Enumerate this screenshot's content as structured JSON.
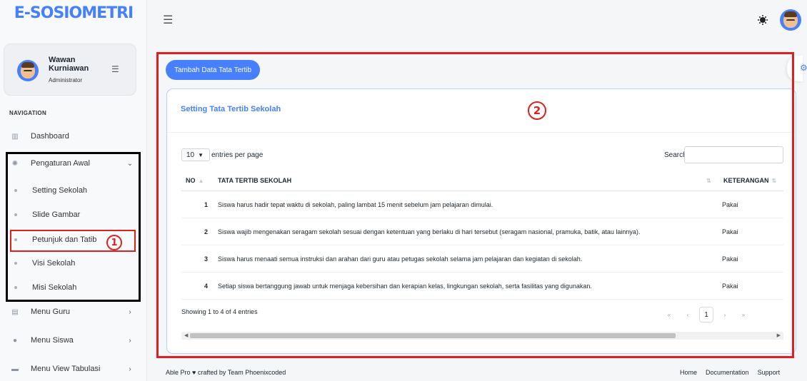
{
  "app": {
    "title": "E-SOSIOMETRI"
  },
  "user": {
    "name": "Wawan Kurniawan",
    "role": "Administrator"
  },
  "nav": {
    "caption": "NAVIGATION",
    "dashboard": "Dashboard",
    "pengaturan": "Pengaturan Awal",
    "sub_items": [
      "Setting Sekolah",
      "Slide Gambar",
      "Petunjuk dan Tatib",
      "Visi Sekolah",
      "Misi Sekolah"
    ],
    "menu_guru": "Menu Guru",
    "menu_siswa": "Menu Siswa",
    "menu_view": "Menu View Tabulasi"
  },
  "annotations": {
    "marker_1": "1",
    "marker_2": "2"
  },
  "main": {
    "add_button": "Tambah Data Tata Tertib",
    "card_title": "Setting Tata Tertib Sekolah",
    "per_page_value": "10",
    "per_page_label": "entries per page",
    "search_label": "Search:",
    "columns": {
      "no": "NO",
      "rule": "TATA TERTIB SEKOLAH",
      "ket": "KETERANGAN"
    },
    "rows": [
      {
        "no": "1",
        "rule": "Siswa harus hadir tepat waktu di sekolah, paling lambat 15 menit sebelum jam pelajaran dimulai.",
        "ket": "Pakai"
      },
      {
        "no": "2",
        "rule": "Siswa wajib mengenakan seragam sekolah sesuai dengan ketentuan yang berlaku di hari tersebut (seragam nasional, pramuka, batik, atau lainnya).",
        "ket": "Pakai"
      },
      {
        "no": "3",
        "rule": "Siswa harus menaati semua instruksi dan arahan dari guru atau petugas sekolah selama jam pelajaran dan kegiatan di sekolah.",
        "ket": "Pakai"
      },
      {
        "no": "4",
        "rule": "Setiap siswa bertanggung jawab untuk menjaga kebersihan dan kerapian kelas, lingkungan sekolah, serta fasilitas yang digunakan.",
        "ket": "Pakai"
      }
    ],
    "showing": "Showing 1 to 4 of 4 entries",
    "pager": {
      "first": "«",
      "prev": "‹",
      "current": "1",
      "next": "›",
      "last": "»"
    }
  },
  "footer": {
    "credit": "Able Pro ♥ crafted by Team Phoenixcoded",
    "links": [
      "Home",
      "Documentation",
      "Support"
    ]
  },
  "colors": {
    "accent": "#4680ff",
    "annotation_red": "#e02020"
  }
}
